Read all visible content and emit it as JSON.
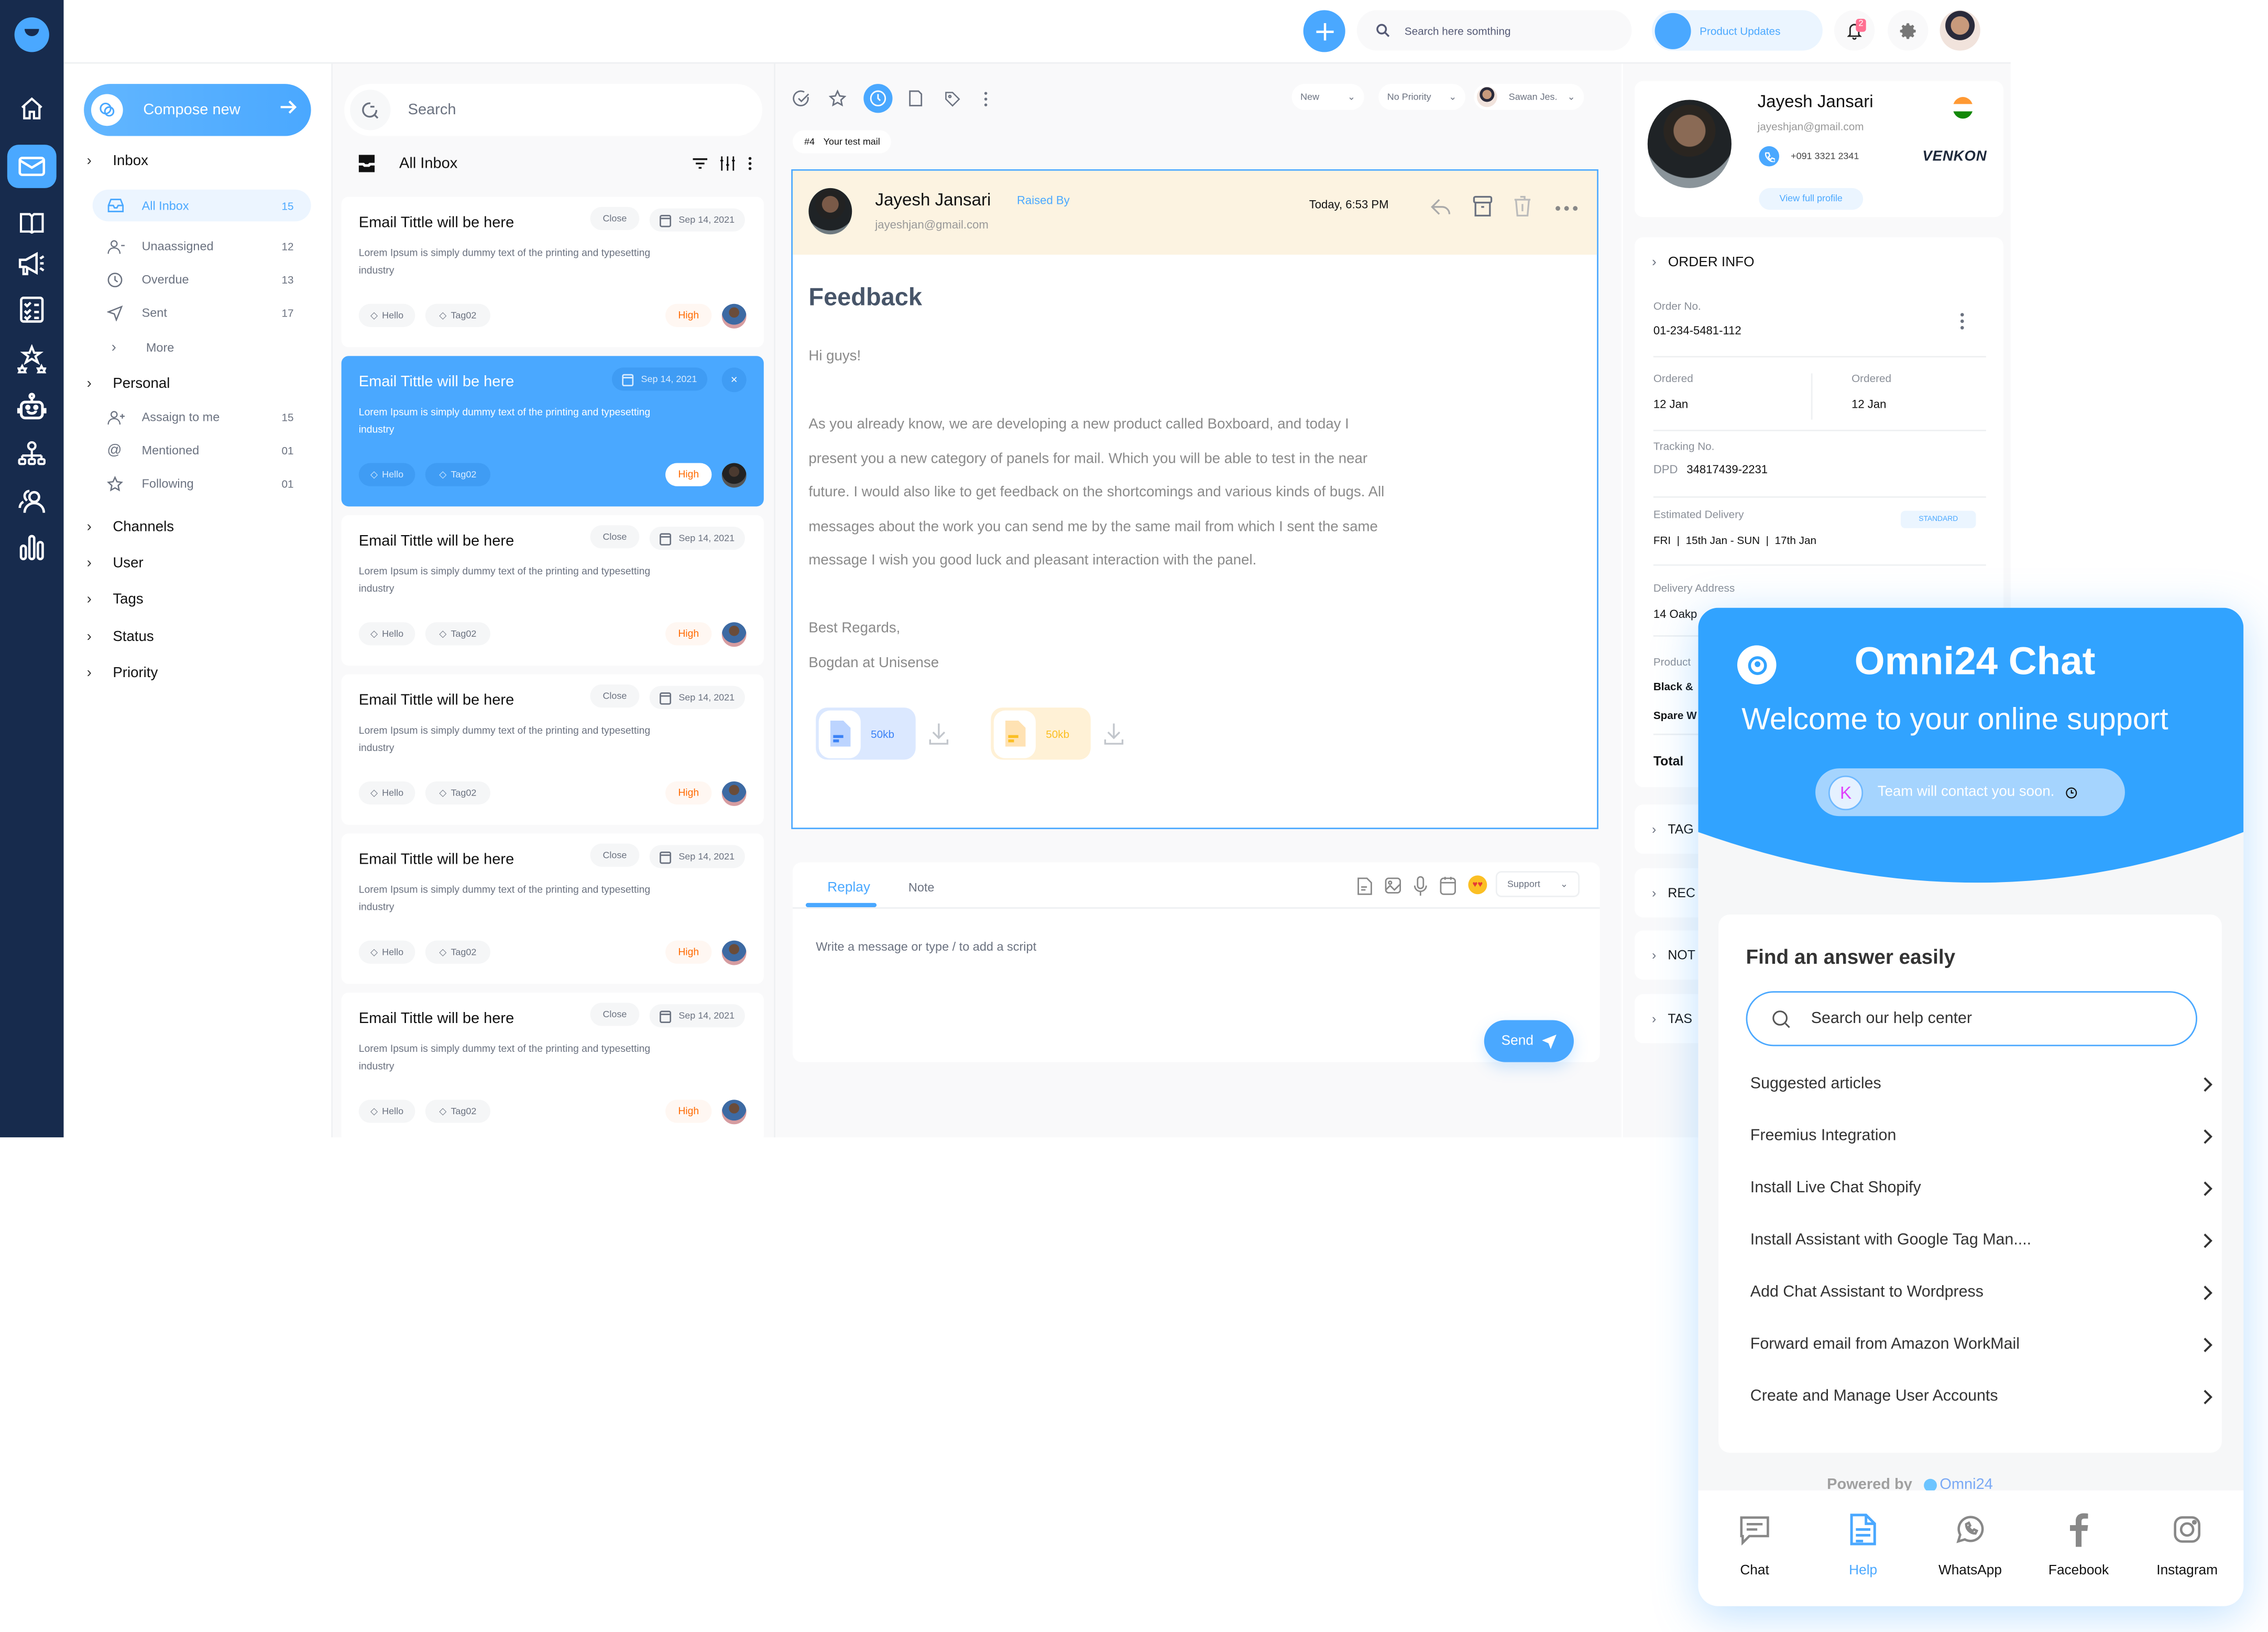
{
  "app": {
    "brand_color": "#4aa8ff",
    "rail_color": "#172b4d"
  },
  "rail": {
    "items": [
      {
        "icon": "home-icon"
      },
      {
        "icon": "mail-icon",
        "active": true
      },
      {
        "icon": "book-icon"
      },
      {
        "icon": "megaphone-icon"
      },
      {
        "icon": "checklist-icon"
      },
      {
        "icon": "stars-icon"
      },
      {
        "icon": "bot-icon"
      },
      {
        "icon": "hierarchy-icon"
      },
      {
        "icon": "users-icon"
      },
      {
        "icon": "bar-chart-icon"
      }
    ]
  },
  "topbar": {
    "search_placeholder": "Search here somthing",
    "product_updates": "Product Updates",
    "notification_count": "2"
  },
  "nav": {
    "compose_label": "Compose new",
    "inbox": {
      "label": "Inbox",
      "items": [
        {
          "label": "All Inbox",
          "count": "15",
          "active": true
        },
        {
          "label": "Unaassigned",
          "count": "12"
        },
        {
          "label": "Overdue",
          "count": "13"
        },
        {
          "label": "Sent",
          "count": "17"
        },
        {
          "label": "More",
          "count": ""
        }
      ]
    },
    "personal": {
      "label": "Personal",
      "items": [
        {
          "label": "Assaign to me",
          "count": "15"
        },
        {
          "label": "Mentioned",
          "count": "01"
        },
        {
          "label": "Following",
          "count": "01"
        }
      ]
    },
    "groups": [
      "Channels",
      "User",
      "Tags",
      "Status",
      "Priority"
    ]
  },
  "list": {
    "search_placeholder": "Search",
    "header": "All Inbox",
    "emails": [
      {
        "title": "Email Tittle will be here",
        "desc": "Lorem Ipsum is simply dummy text of the printing and typesetting industry",
        "status": "Close",
        "date": "Sep 14, 2021",
        "tags": [
          "Hello",
          "Tag02"
        ],
        "priority": "High"
      },
      {
        "title": "Email Tittle will be here",
        "desc": "Lorem Ipsum is simply dummy text of the printing and typesetting industry",
        "status": "",
        "date": "Sep 14, 2021",
        "tags": [
          "Hello",
          "Tag02"
        ],
        "priority": "High",
        "selected": true
      },
      {
        "title": "Email Tittle will be here",
        "desc": "Lorem Ipsum is simply dummy text of the printing and typesetting industry",
        "status": "Close",
        "date": "Sep 14, 2021",
        "tags": [
          "Hello",
          "Tag02"
        ],
        "priority": "High"
      },
      {
        "title": "Email Tittle will be here",
        "desc": "Lorem Ipsum is simply dummy text of the printing and typesetting industry",
        "status": "Close",
        "date": "Sep 14, 2021",
        "tags": [
          "Hello",
          "Tag02"
        ],
        "priority": "High"
      },
      {
        "title": "Email Tittle will be here",
        "desc": "Lorem Ipsum is simply dummy text of the printing and typesetting industry",
        "status": "Close",
        "date": "Sep 14, 2021",
        "tags": [
          "Hello",
          "Tag02"
        ],
        "priority": "High"
      },
      {
        "title": "Email Tittle will be here",
        "desc": "Lorem Ipsum is simply dummy text of the printing and typesetting industry",
        "status": "Close",
        "date": "Sep 14, 2021",
        "tags": [
          "Hello",
          "Tag02"
        ],
        "priority": "High"
      }
    ]
  },
  "main": {
    "status_dropdown": "New",
    "priority_dropdown": "No Priority",
    "assignee_dropdown": "Sawan Jes.",
    "ticket_id": "#4",
    "ticket_subject": "Your test mail",
    "sender_name": "Jayesh Jansari",
    "raised_by": "Raised By",
    "sender_email": "jayeshjan@gmail.com",
    "time": "Today, 6:53 PM",
    "subject": "Feedback",
    "greeting": "Hi guys!",
    "body_lines": [
      "As you already know, we are developing a new product called Boxboard, and today I",
      "present you a new category of panels for mail. Which you will be able to test in the near",
      "future. I would also like to get feedback on the shortcomings and various kinds of bugs. All",
      "messages about the work you can send me by the same mail from which I sent the same",
      "message I wish you good luck and pleasant interaction with the panel."
    ],
    "regards": "Best Regards,",
    "signature": "Bogdan at Unisense",
    "attachments": [
      {
        "size": "50kb",
        "color": "#3b82f6"
      },
      {
        "size": "50kb",
        "color": "#fbbf24"
      }
    ],
    "reply": {
      "tabs": [
        "Replay",
        "Note"
      ],
      "active_tab": "Replay",
      "placeholder": "Write a message or type / to add  a script",
      "team_select": "Support",
      "send_label": "Send"
    }
  },
  "profile": {
    "name": "Jayesh Jansari",
    "email": "jayeshjan@gmail.com",
    "phone": "+091 3321 2341",
    "company": "VENKON",
    "view_profile": "View full profile"
  },
  "order": {
    "title": "ORDER INFO",
    "order_no_label": "Order No.",
    "order_no": "01-234-5481-112",
    "ordered_label_1": "Ordered",
    "ordered_value_1": "12 Jan",
    "ordered_label_2": "Ordered",
    "ordered_value_2": "12 Jan",
    "tracking_label": "Tracking No.",
    "tracking_carrier": "DPD",
    "tracking_no": "34817439-2231",
    "est_label": "Estimated Delivery",
    "shipping_badge": "STANDARD",
    "est_value": "FRI  |  15th Jan - SUN  |  17th Jan",
    "address_label": "Delivery Address",
    "address_value": "14 Oakp",
    "product_label": "Product",
    "product_1": "Black &",
    "product_2": "Spare W",
    "total_label": "Total"
  },
  "side_sections": [
    "TAG",
    "REC",
    "NOT",
    "TAS"
  ],
  "chat": {
    "title": "Omni24 Chat",
    "welcome": "Welcome to your online support",
    "agent_initial": "K",
    "status_text": "Team will contact you soon.",
    "find_title": "Find an answer easily",
    "search_placeholder": "Search our help center",
    "articles": [
      "Suggested articles",
      "Freemius Integration",
      "Install Live Chat Shopify",
      "Install Assistant with Google Tag Man....",
      "Add Chat Assistant to Wordpress",
      "Forward email from Amazon WorkMail",
      "Create and Manage User Accounts"
    ],
    "powered_by": "Powered by",
    "powered_brand": "Omni24",
    "tabs": [
      "Chat",
      "Help",
      "WhatsApp",
      "Facebook",
      "Instagram"
    ],
    "active_tab": "Help"
  }
}
